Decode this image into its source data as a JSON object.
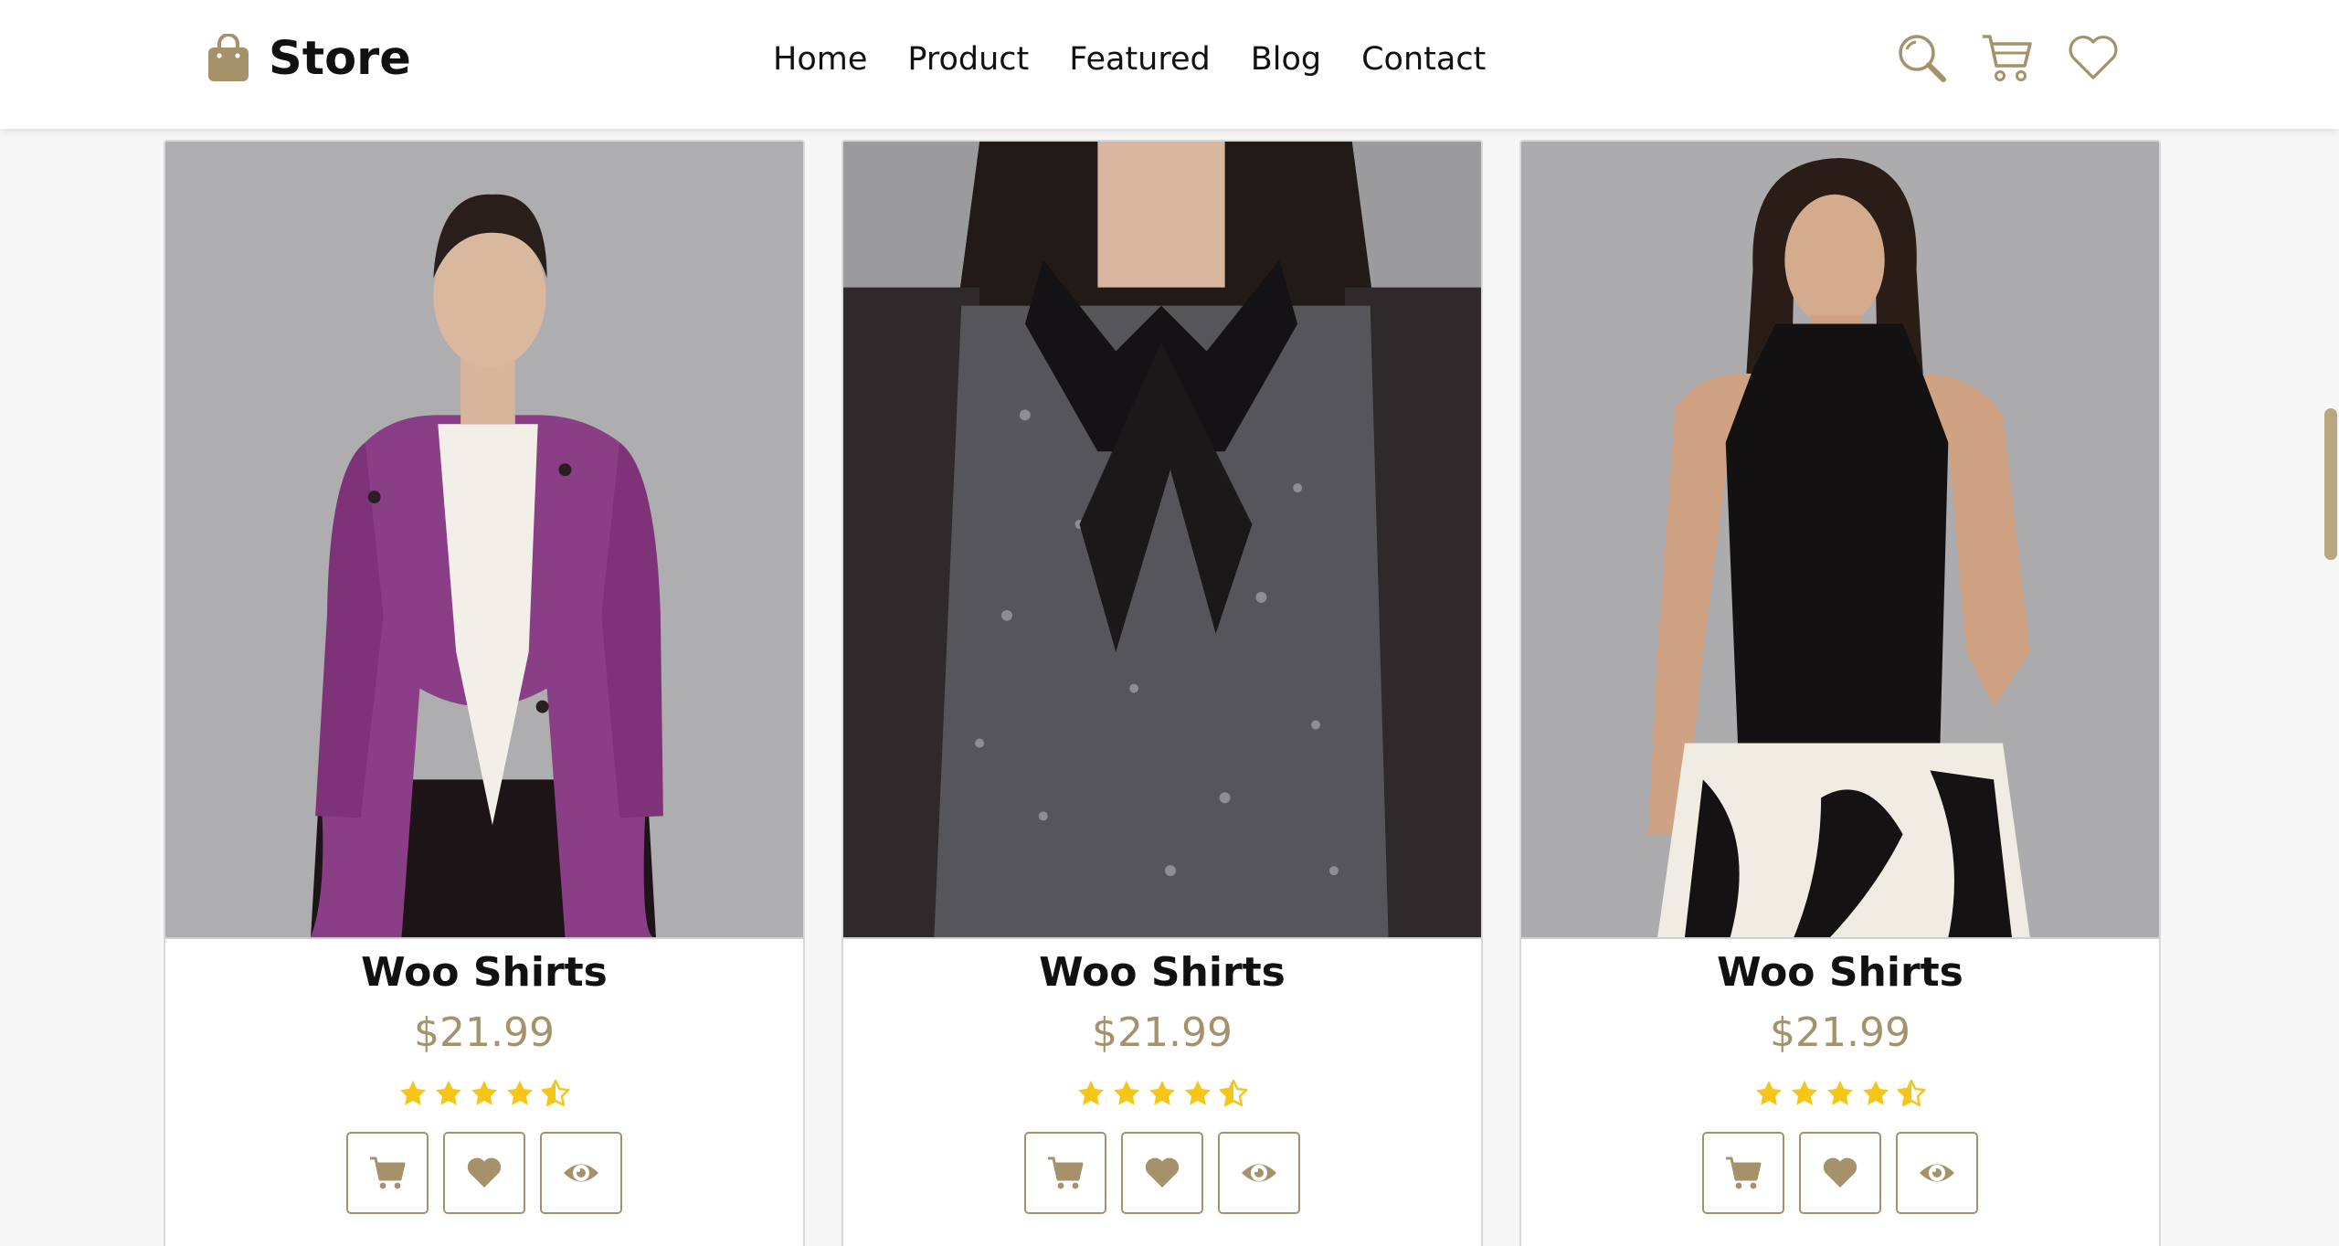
{
  "header": {
    "brand": "Store",
    "nav": [
      "Home",
      "Product",
      "Featured",
      "Blog",
      "Contact"
    ]
  },
  "icons": {
    "logo": "shopping-bag-icon",
    "search": "search-icon",
    "cart": "cart-icon",
    "wishlist": "heart-icon",
    "card_cart": "cart-icon",
    "card_wishlist": "heart-icon",
    "card_view": "eye-icon",
    "star": "star-icon",
    "star_half": "star-half-icon"
  },
  "colors": {
    "accent": "#a5926a",
    "star": "#f5c518"
  },
  "products": [
    {
      "title": "Woo Shirts",
      "price": "$21.99",
      "rating": 4.5
    },
    {
      "title": "Woo Shirts",
      "price": "$21.99",
      "rating": 4.5
    },
    {
      "title": "Woo Shirts",
      "price": "$21.99",
      "rating": 4.5
    }
  ]
}
